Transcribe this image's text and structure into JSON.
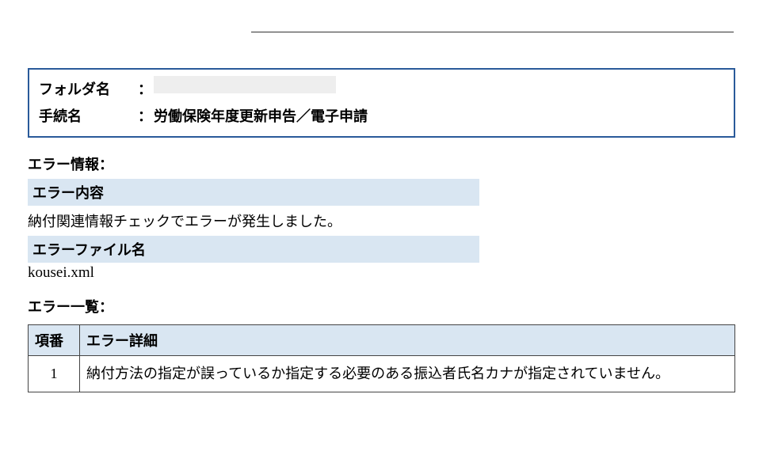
{
  "info_box": {
    "folder_label": "フォルダ名",
    "folder_value_redacted": true,
    "procedure_label": "手続名",
    "procedure_value": "労働保険年度更新申告／電子申請",
    "colon": "："
  },
  "error_info_label": "エラー情報：",
  "error_content_heading": "エラー内容",
  "error_content_text": "納付関連情報チェックでエラーが発生しました。",
  "error_file_heading": "エラーファイル名",
  "error_file_text": "kousei.xml",
  "error_list_label": "エラー一覧：",
  "error_table": {
    "col_num": "項番",
    "col_detail": "エラー詳細",
    "rows": [
      {
        "num": "1",
        "detail": "納付方法の指定が誤っているか指定する必要のある振込者氏名カナが指定されていません。"
      }
    ]
  }
}
